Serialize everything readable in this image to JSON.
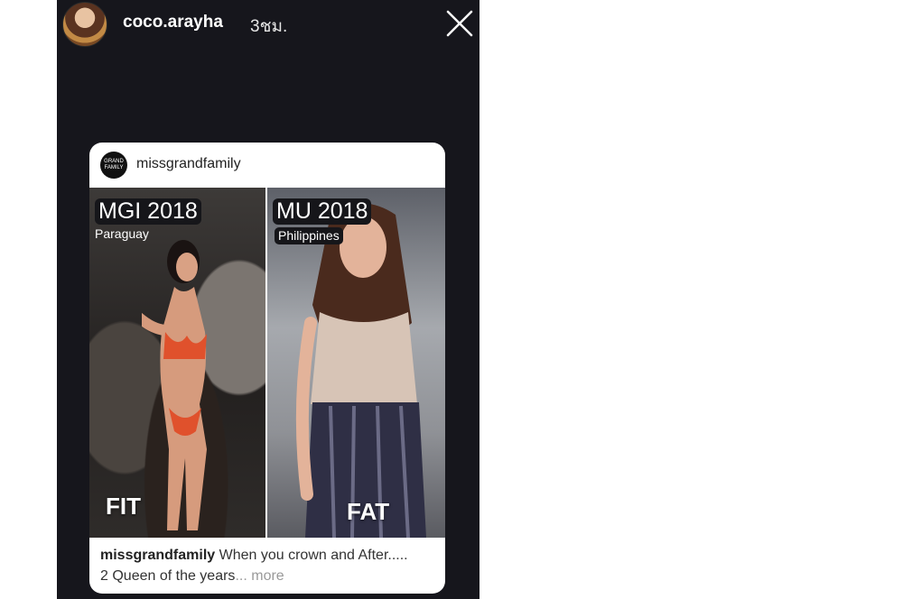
{
  "story": {
    "username": "coco.arayha",
    "time": "3ชม."
  },
  "post": {
    "handle": "missgrandfamily",
    "avatar_text_line1": "GRAND",
    "avatar_text_line2": "FAMILY",
    "left_panel": {
      "title": "MGI 2018",
      "country": "Paraguay",
      "bottom_label": "FIT"
    },
    "right_panel": {
      "title": "MU 2018",
      "country": "Philippines",
      "bottom_label": "FAT"
    },
    "caption": {
      "handle": "missgrandfamily",
      "line1": "When you crown and After.....",
      "line2": "2 Queen of the years",
      "ellipsis": "...",
      "more": "more"
    }
  },
  "icons": {
    "close": "close-icon"
  },
  "colors": {
    "story_background": "#16161c",
    "post_background": "#ffffff",
    "page_background": "#ffffff"
  }
}
